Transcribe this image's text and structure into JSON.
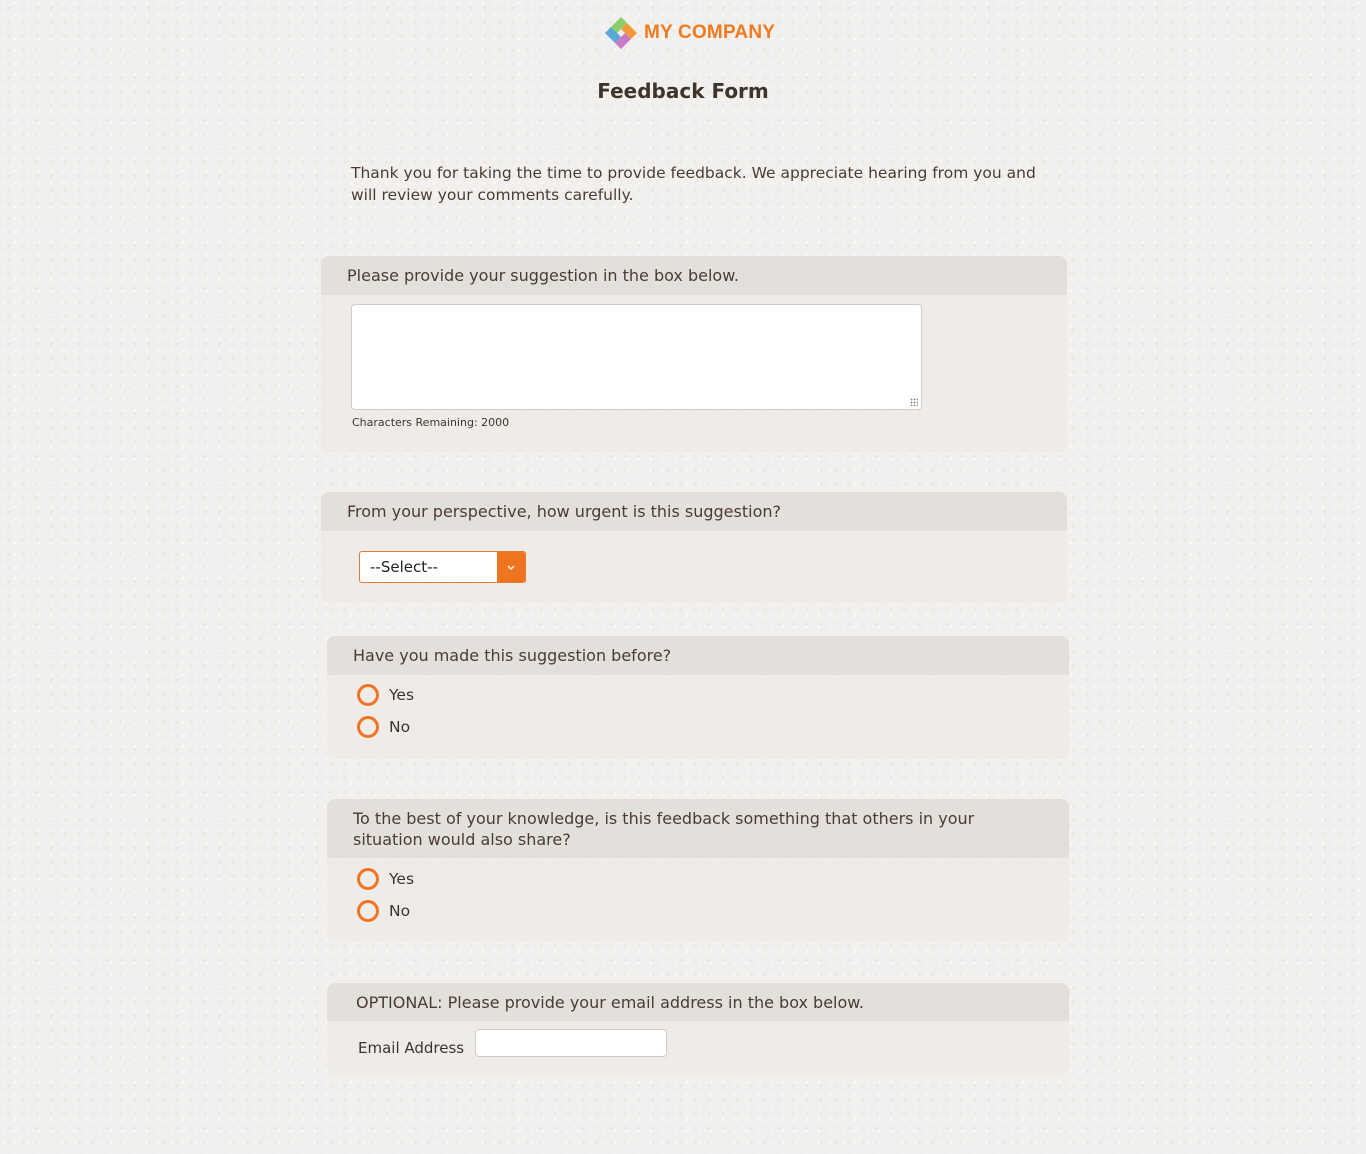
{
  "header": {
    "logo_text": "MY COMPANY",
    "title": "Feedback Form"
  },
  "intro": "Thank you for taking the time to provide feedback. We appreciate hearing from you and will review your comments carefully.",
  "q1": {
    "label": "Please provide your suggestion in the box below.",
    "value": "",
    "chars_remaining": "Characters Remaining: 2000"
  },
  "q2": {
    "label": "From your perspective, how urgent is this suggestion?",
    "selected": "--Select--"
  },
  "q3": {
    "label": "Have you made this suggestion before?",
    "options": [
      "Yes",
      "No"
    ]
  },
  "q4": {
    "label": "To the best of your knowledge, is this feedback something that others in your situation would also share?",
    "options": [
      "Yes",
      "No"
    ]
  },
  "q5": {
    "label": "OPTIONAL: Please provide your email address in the box below.",
    "field_label": "Email Address",
    "value": ""
  },
  "colors": {
    "accent": "#ee7420",
    "text": "#4a3c32",
    "section_header": "#e3e0db"
  },
  "icons": {
    "logo": "diamond-logo-icon",
    "dropdown": "chevron-down-icon"
  }
}
